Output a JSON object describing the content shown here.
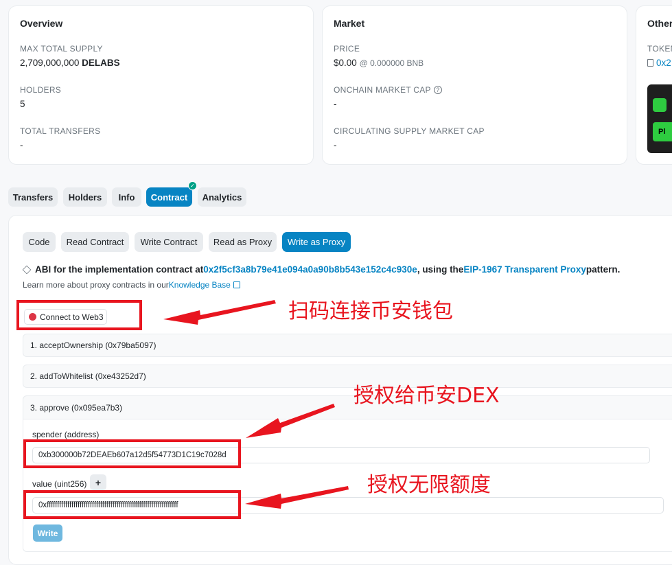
{
  "overview": {
    "title": "Overview",
    "max_supply_label": "MAX TOTAL SUPPLY",
    "max_supply_value": "2,709,000,000",
    "max_supply_symbol": "DELABS",
    "holders_label": "HOLDERS",
    "holders_value": "5",
    "transfers_label": "TOTAL TRANSFERS",
    "transfers_value": "-"
  },
  "market": {
    "title": "Market",
    "price_label": "PRICE",
    "price_value": "$0.00",
    "price_bnb": "@ 0.000000 BNB",
    "onchain_cap_label": "ONCHAIN MARKET CAP",
    "onchain_cap_value": "-",
    "circ_cap_label": "CIRCULATING SUPPLY MARKET CAP",
    "circ_cap_value": "-"
  },
  "other": {
    "title": "Other",
    "token_label": "TOKEN",
    "token_value": "0x2",
    "ad_button": "Pl"
  },
  "tabs": [
    "Transfers",
    "Holders",
    "Info",
    "Contract",
    "Analytics"
  ],
  "subtabs": [
    "Code",
    "Read Contract",
    "Write Contract",
    "Read as Proxy",
    "Write as Proxy"
  ],
  "abi": {
    "prefix": "ABI for the implementation contract at ",
    "address": "0x2f5cf3a8b79e41e094a0a90b8b543e152c4c930e",
    "middle": ", using the ",
    "pattern_link": "EIP-1967 Transparent Proxy",
    "suffix": " pattern.",
    "learn_prefix": "Learn more about proxy contracts in our ",
    "learn_link": "Knowledge Base"
  },
  "connect_label": "Connect to Web3",
  "functions": [
    "1. acceptOwnership (0x79ba5097)",
    "2. addToWhitelist (0xe43252d7)",
    "3. approve (0x095ea7b3)"
  ],
  "approve": {
    "spender_label": "spender (address)",
    "spender_value": "0xb300000b72DEAEb607a12d5f54773D1C19c7028d",
    "value_label": "value (uint256)",
    "plus_label": "+",
    "value_value": "0xffffffffffffffffffffffffffffffffffffffffffffffffffffffffffffffff",
    "write_label": "Write"
  },
  "annotations": {
    "connect": "扫码连接币安钱包",
    "approve": "授权给币安DEX",
    "unlimited": "授权无限额度"
  },
  "colors": {
    "accent": "#0784c3",
    "annotation_red": "#e8151f",
    "status_dot": "#dc3545",
    "verified_green": "#00a186"
  }
}
